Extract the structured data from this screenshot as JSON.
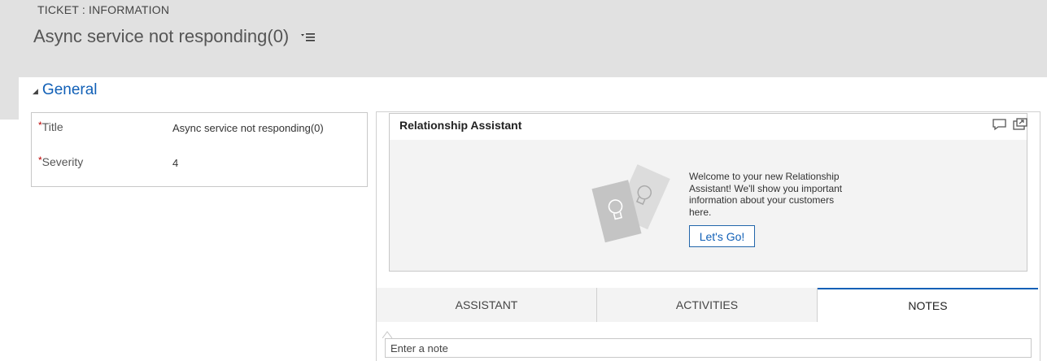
{
  "header": {
    "entity_label": "TICKET : INFORMATION",
    "record_title": "Async service not responding(0)",
    "title_menu_icon": "list-menu-icon"
  },
  "section": {
    "title": "General",
    "toggle_icon": "collapse-triangle-icon"
  },
  "fields": [
    {
      "label": "Title",
      "required": true,
      "required_mark": "*",
      "value": "Async service not responding(0)"
    },
    {
      "label": "Severity",
      "required": true,
      "required_mark": "*",
      "value": "4"
    }
  ],
  "assistant": {
    "title": "Relationship Assistant",
    "icons": [
      "feedback-icon",
      "popout-icon"
    ],
    "welcome_text": "Welcome to your new Relationship Assistant! We'll show you important information about your customers here.",
    "cta_label": "Let's Go!",
    "illustration_icon": "lightbulb-cards-icon"
  },
  "tabs": [
    {
      "label": "ASSISTANT",
      "active": false
    },
    {
      "label": "ACTIVITIES",
      "active": false
    },
    {
      "label": "NOTES",
      "active": true
    }
  ],
  "notes": {
    "placeholder": "Enter a note"
  },
  "colors": {
    "header_bg": "#e1e1e1",
    "accent_blue": "#1160b7",
    "panel_bg": "#f3f3f3",
    "required_red": "#bb0000"
  }
}
